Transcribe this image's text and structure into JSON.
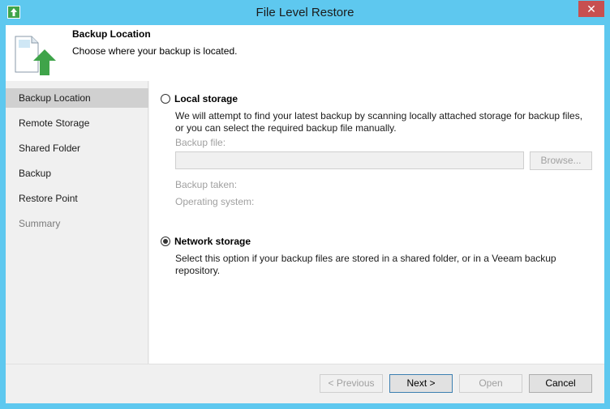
{
  "window": {
    "title": "File Level Restore",
    "close_label": "✕"
  },
  "header": {
    "title": "Backup Location",
    "subtitle": "Choose where your backup is located."
  },
  "sidebar": {
    "items": [
      {
        "label": "Backup Location",
        "state": "active"
      },
      {
        "label": "Remote Storage",
        "state": "enabled"
      },
      {
        "label": "Shared Folder",
        "state": "enabled"
      },
      {
        "label": "Backup",
        "state": "enabled"
      },
      {
        "label": "Restore Point",
        "state": "enabled"
      },
      {
        "label": "Summary",
        "state": "disabled"
      }
    ]
  },
  "local": {
    "label": "Local storage",
    "selected": false,
    "desc_line1": "We will attempt to find your latest backup by scanning locally attached storage for backup files,",
    "desc_line2": "or you can select the required backup file manually.",
    "backup_file_label": "Backup file:",
    "backup_file_value": "",
    "browse_label": "Browse...",
    "backup_taken_label": "Backup taken:",
    "os_label": "Operating system:"
  },
  "network": {
    "label": "Network storage",
    "selected": true,
    "desc_line1": "Select this option if your backup files are stored in a shared folder, or in a Veeam backup",
    "desc_line2": "repository."
  },
  "footer": {
    "previous_label": "< Previous",
    "next_label": "Next >",
    "open_label": "Open",
    "cancel_label": "Cancel"
  },
  "colors": {
    "titlebar": "#5ec8ef",
    "close": "#c75050",
    "accent_green": "#3fa44a"
  }
}
